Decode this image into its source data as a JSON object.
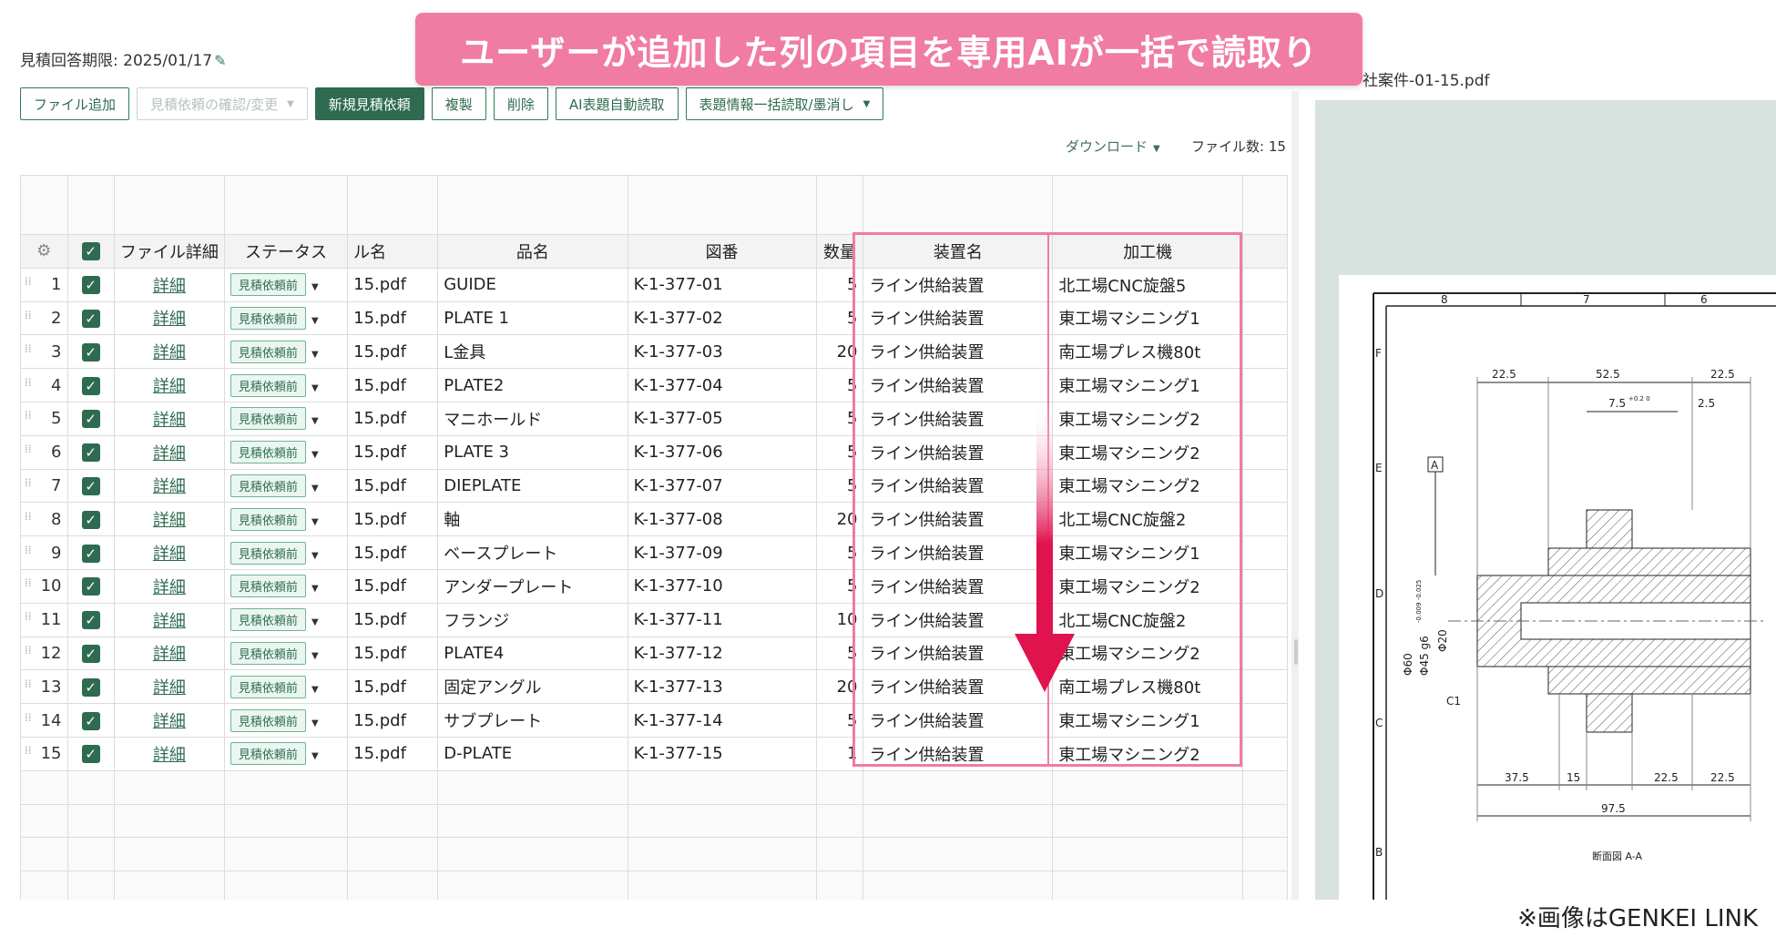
{
  "banner": "ユーザーが追加した列の項目を専用AIが一括で読取り",
  "deadline": "見積回答期限: 2025/01/17",
  "toolbar": {
    "add_file": "ファイル追加",
    "confirm": "見積依頼の確認/変更",
    "new_request": "新規見積依頼",
    "duplicate": "複製",
    "delete": "削除",
    "ai_read": "AI表題自動読取",
    "bulk_read": "表題情報一括読取/墨消し"
  },
  "download": "ダウンロード",
  "file_count": "ファイル数: 15",
  "pdf_title": "社案件-01-15.pdf",
  "columns": {
    "detail": "ファイル詳細",
    "status": "ステータス",
    "filename": "ル名",
    "part": "品名",
    "drawing": "図番",
    "qty": "数量",
    "device": "装置名",
    "machine": "加工機"
  },
  "rows": [
    {
      "no": "1",
      "detail": "詳細",
      "status": "見積依頼前",
      "file": "15.pdf",
      "part": "GUIDE",
      "drawing": "K-1-377-01",
      "qty": "5",
      "device": "ライン供給装置",
      "machine": "北工場CNC旋盤5"
    },
    {
      "no": "2",
      "detail": "詳細",
      "status": "見積依頼前",
      "file": "15.pdf",
      "part": "PLATE 1",
      "drawing": "K-1-377-02",
      "qty": "5",
      "device": "ライン供給装置",
      "machine": "東工場マシニング1"
    },
    {
      "no": "3",
      "detail": "詳細",
      "status": "見積依頼前",
      "file": "15.pdf",
      "part": "L金具",
      "drawing": "K-1-377-03",
      "qty": "20",
      "device": "ライン供給装置",
      "machine": "南工場プレス機80t"
    },
    {
      "no": "4",
      "detail": "詳細",
      "status": "見積依頼前",
      "file": "15.pdf",
      "part": "PLATE2",
      "drawing": "K-1-377-04",
      "qty": "5",
      "device": "ライン供給装置",
      "machine": "東工場マシニング1"
    },
    {
      "no": "5",
      "detail": "詳細",
      "status": "見積依頼前",
      "file": "15.pdf",
      "part": "マニホールド",
      "drawing": "K-1-377-05",
      "qty": "5",
      "device": "ライン供給装置",
      "machine": "東工場マシニング2"
    },
    {
      "no": "6",
      "detail": "詳細",
      "status": "見積依頼前",
      "file": "15.pdf",
      "part": "PLATE 3",
      "drawing": "K-1-377-06",
      "qty": "5",
      "device": "ライン供給装置",
      "machine": "東工場マシニング2"
    },
    {
      "no": "7",
      "detail": "詳細",
      "status": "見積依頼前",
      "file": "15.pdf",
      "part": "DIEPLATE",
      "drawing": "K-1-377-07",
      "qty": "5",
      "device": "ライン供給装置",
      "machine": "東工場マシニング2"
    },
    {
      "no": "8",
      "detail": "詳細",
      "status": "見積依頼前",
      "file": "15.pdf",
      "part": "軸",
      "drawing": "K-1-377-08",
      "qty": "20",
      "device": "ライン供給装置",
      "machine": "北工場CNC旋盤2"
    },
    {
      "no": "9",
      "detail": "詳細",
      "status": "見積依頼前",
      "file": "15.pdf",
      "part": "ベースプレート",
      "drawing": "K-1-377-09",
      "qty": "5",
      "device": "ライン供給装置",
      "machine": "東工場マシニング1"
    },
    {
      "no": "10",
      "detail": "詳細",
      "status": "見積依頼前",
      "file": "15.pdf",
      "part": "アンダープレート",
      "drawing": "K-1-377-10",
      "qty": "5",
      "device": "ライン供給装置",
      "machine": "東工場マシニング2"
    },
    {
      "no": "11",
      "detail": "詳細",
      "status": "見積依頼前",
      "file": "15.pdf",
      "part": "フランジ",
      "drawing": "K-1-377-11",
      "qty": "10",
      "device": "ライン供給装置",
      "machine": "北工場CNC旋盤2"
    },
    {
      "no": "12",
      "detail": "詳細",
      "status": "見積依頼前",
      "file": "15.pdf",
      "part": "PLATE4",
      "drawing": "K-1-377-12",
      "qty": "5",
      "device": "ライン供給装置",
      "machine": "東工場マシニング2"
    },
    {
      "no": "13",
      "detail": "詳細",
      "status": "見積依頼前",
      "file": "15.pdf",
      "part": "固定アングル",
      "drawing": "K-1-377-13",
      "qty": "20",
      "device": "ライン供給装置",
      "machine": "南工場プレス機80t"
    },
    {
      "no": "14",
      "detail": "詳細",
      "status": "見積依頼前",
      "file": "15.pdf",
      "part": "サブプレート",
      "drawing": "K-1-377-14",
      "qty": "5",
      "device": "ライン供給装置",
      "machine": "東工場マシニング1"
    },
    {
      "no": "15",
      "detail": "詳細",
      "status": "見積依頼前",
      "file": "15.pdf",
      "part": "D-PLATE",
      "drawing": "K-1-377-15",
      "qty": "1",
      "device": "ライン供給装置",
      "machine": "東工場マシニング2"
    }
  ],
  "drawing": {
    "zones_top": [
      "8",
      "7",
      "6"
    ],
    "zones_left": [
      "F",
      "E",
      "D",
      "C",
      "B"
    ],
    "dims": [
      "22.5",
      "52.5",
      "22.5",
      "7.5",
      "2.5",
      "37.5",
      "15",
      "22.5",
      "22.5",
      "97.5"
    ],
    "tol_small": "+0.2 0",
    "datum": "A",
    "dia_labels": [
      "Φ60",
      "Φ45 g6",
      "Φ20"
    ],
    "g6_tol": "-0.009 -0.025",
    "chamfer": "C1",
    "caption": "断面図 A-A"
  },
  "credit": "※画像はGENKEI LINK",
  "colors": {
    "brand": "#2e6b50",
    "highlight": "#f07ba3",
    "arrow": "#e0134f"
  }
}
